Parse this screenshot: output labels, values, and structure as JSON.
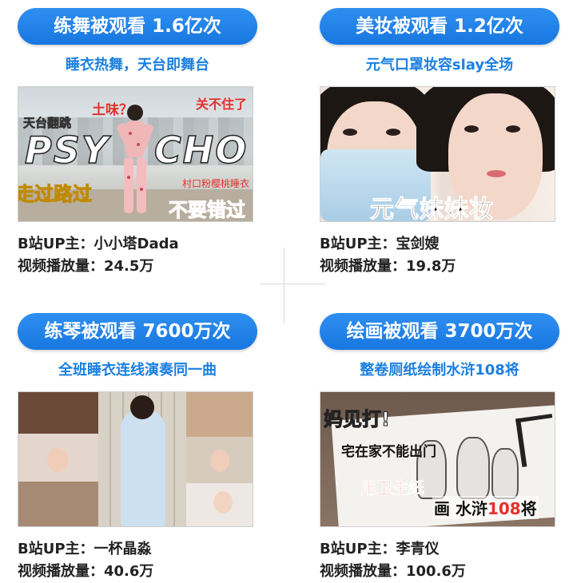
{
  "cards": [
    {
      "pill": "练舞被观看 1.6亿次",
      "subtitle": "睡衣热舞，天台即舞台",
      "thumb_text": {
        "q": "土味？",
        "roof": "天台翻跳",
        "big_left": "PSY",
        "big_right": "CHO",
        "red_top": "关不住了",
        "pass": "走过路过",
        "miss": "不要错过",
        "sleepwear": "村口粉樱桃睡衣"
      },
      "uploader_label": "B站UP主：",
      "uploader": "小小塔Dada",
      "views_label": "视频播放量：",
      "views": "24.5万"
    },
    {
      "pill": "美妆被观看 1.2亿次",
      "subtitle": "元气口罩妆容slay全场",
      "thumb_text": {
        "caption": "元气妹妹妆"
      },
      "uploader_label": "B站UP主：",
      "uploader": "宝剑嫂",
      "views_label": "视频播放量：",
      "views": "19.8万"
    },
    {
      "pill": "练琴被观看 7600万次",
      "subtitle": "全班睡衣连线演奏同一曲",
      "thumb_text": {},
      "uploader_label": "B站UP主：",
      "uploader": "一杯晶淼",
      "views_label": "视频播放量：",
      "views": "40.6万"
    },
    {
      "pill": "绘画被观看 3700万次",
      "subtitle": "整卷厕纸绘制水浒108将",
      "thumb_text": {
        "mom": "妈见打!",
        "home": "宅在家不能出门",
        "tp": "用卫生纸",
        "draw": "画 水浒",
        "num": "108",
        "generals": "将"
      },
      "uploader_label": "B站UP主：",
      "uploader": "李青仪",
      "views_label": "视频播放量：",
      "views": "100.6万"
    }
  ],
  "colors": {
    "pill_blue": "#1877e0",
    "subtitle_blue": "#1a7fe0",
    "accent_red": "#e4312c"
  }
}
